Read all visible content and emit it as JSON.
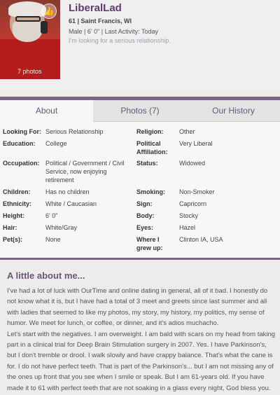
{
  "profile": {
    "username": "LiberalLad",
    "age_location": "61 | Saint Francis, WI",
    "details": "Male | 6' 0\" | Last Activity: Today",
    "tagline": "I'm looking for a serious relationship.",
    "photo_count": "7 photos"
  },
  "tabs": [
    {
      "label": "About",
      "active": true
    },
    {
      "label": "Photos (7)",
      "active": false
    },
    {
      "label": "Our History",
      "active": false
    }
  ],
  "info": {
    "looking_for": {
      "label": "Looking For:",
      "value": "Serious Relationship"
    },
    "religion": {
      "label": "Religion:",
      "value": "Other"
    },
    "education": {
      "label": "Education:",
      "value": "College"
    },
    "political": {
      "label": "Political Affiliation:",
      "value": "Very Liberal"
    },
    "occupation": {
      "label": "Occupation:",
      "value": "Political / Government / Civil Service, now enjoying retirement"
    },
    "status": {
      "label": "Status:",
      "value": "Widowed"
    },
    "children": {
      "label": "Children:",
      "value": "Has no children"
    },
    "smoking": {
      "label": "Smoking:",
      "value": "Non-Smoker"
    },
    "ethnicity": {
      "label": "Ethnicity:",
      "value": "White / Caucasian"
    },
    "sign": {
      "label": "Sign:",
      "value": "Capricorn"
    },
    "height": {
      "label": "Height:",
      "value": "6' 0\""
    },
    "body": {
      "label": "Body:",
      "value": "Stocky"
    },
    "hair": {
      "label": "Hair:",
      "value": "White/Gray"
    },
    "eyes": {
      "label": "Eyes:",
      "value": "Hazel"
    },
    "pets": {
      "label": "Pet(s):",
      "value": "None"
    },
    "grew_up": {
      "label": "Where I grew up:",
      "value": "Clinton IA, USA"
    }
  },
  "about": {
    "title": "A little about me...",
    "text": "I've had a lot of luck with OurTime and online dating in general, all of it bad. I honestly do not know what it is, but I have had a total of 3 meet and greets since last summer and all with ladies that seemed to like my photos, my story, my history, my politics, my sense of humor. We meet for lunch, or coffee, or dinner, and it's adios muchacho.\nLet's start with the negatives. I am overweight. I am bald with scars on my head from taking part in a clinical trial for Deep Brain Stimulation surgery in 2007. Yes. I have Parkinson's, but I don't tremble or drool. I walk slowly and have crappy balance. That's what the cane is for. I do not have perfect teeth. That is part of the Parkinson's... but I am not missing any of the ones up front that you see when I smile or speak. But I am 61-years old. If you have made it to 61 with perfect teeth that are not soaking in a glass every night, God bless you."
  },
  "colors": {
    "accent": "#7a6584",
    "username": "#5e3a6e",
    "tab_text": "#6a557a"
  }
}
